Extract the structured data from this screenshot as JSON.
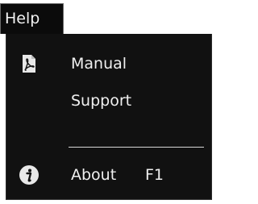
{
  "menubar": {
    "help_label": "Help"
  },
  "menu": {
    "items": [
      {
        "label": "Manual",
        "icon": "pdf-icon",
        "shortcut": ""
      },
      {
        "label": "Support",
        "icon": "",
        "shortcut": ""
      },
      {
        "label": "About",
        "icon": "info-icon",
        "shortcut": "F1"
      }
    ]
  },
  "colors": {
    "menu_background": "#111111",
    "text": "#f0f0f0",
    "separator": "#d8d8d8"
  }
}
